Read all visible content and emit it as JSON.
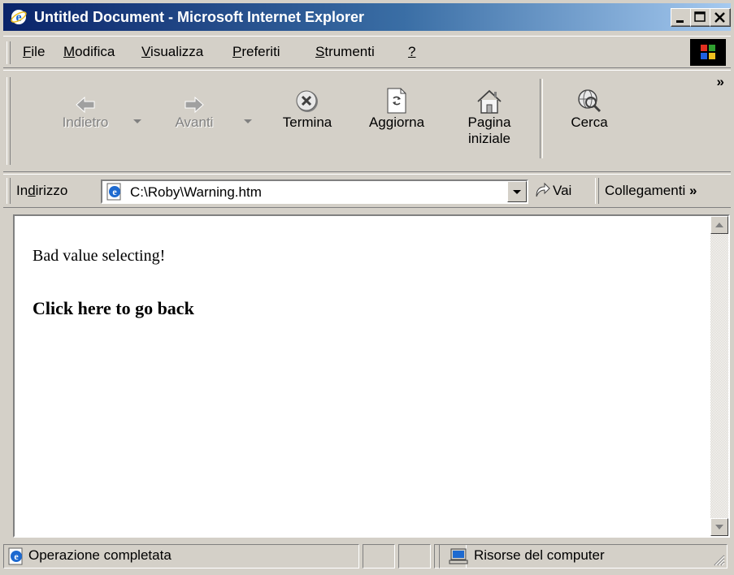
{
  "window": {
    "title": "Untitled Document - Microsoft Internet Explorer"
  },
  "menu": {
    "items": [
      {
        "label": "File",
        "accel": "F"
      },
      {
        "label": "Modifica",
        "accel": "M"
      },
      {
        "label": "Visualizza",
        "accel": "V"
      },
      {
        "label": "Preferiti",
        "accel": "P"
      },
      {
        "label": "Strumenti",
        "accel": "S"
      },
      {
        "label": "?",
        "accel": "?"
      }
    ]
  },
  "toolbar": {
    "back_label": "Indietro",
    "forward_label": "Avanti",
    "stop_label": "Termina",
    "refresh_label": "Aggiorna",
    "home_label_1": "Pagina",
    "home_label_2": "iniziale",
    "search_label": "Cerca",
    "more_label": "»"
  },
  "address": {
    "label_pre": "In",
    "label_accel": "d",
    "label_post": "irizzo",
    "url": "C:\\Roby\\Warning.htm",
    "go_label": "Vai",
    "links_label": "Collegamenti",
    "links_more": "»"
  },
  "page": {
    "message": "Bad value selecting!",
    "back_link": "Click here to go back"
  },
  "status": {
    "text": "Operazione completata",
    "zone": "Risorse del computer"
  },
  "colors": {
    "title_start": "#0a246a",
    "title_end": "#a6caf0",
    "face": "#d4d0c8"
  }
}
